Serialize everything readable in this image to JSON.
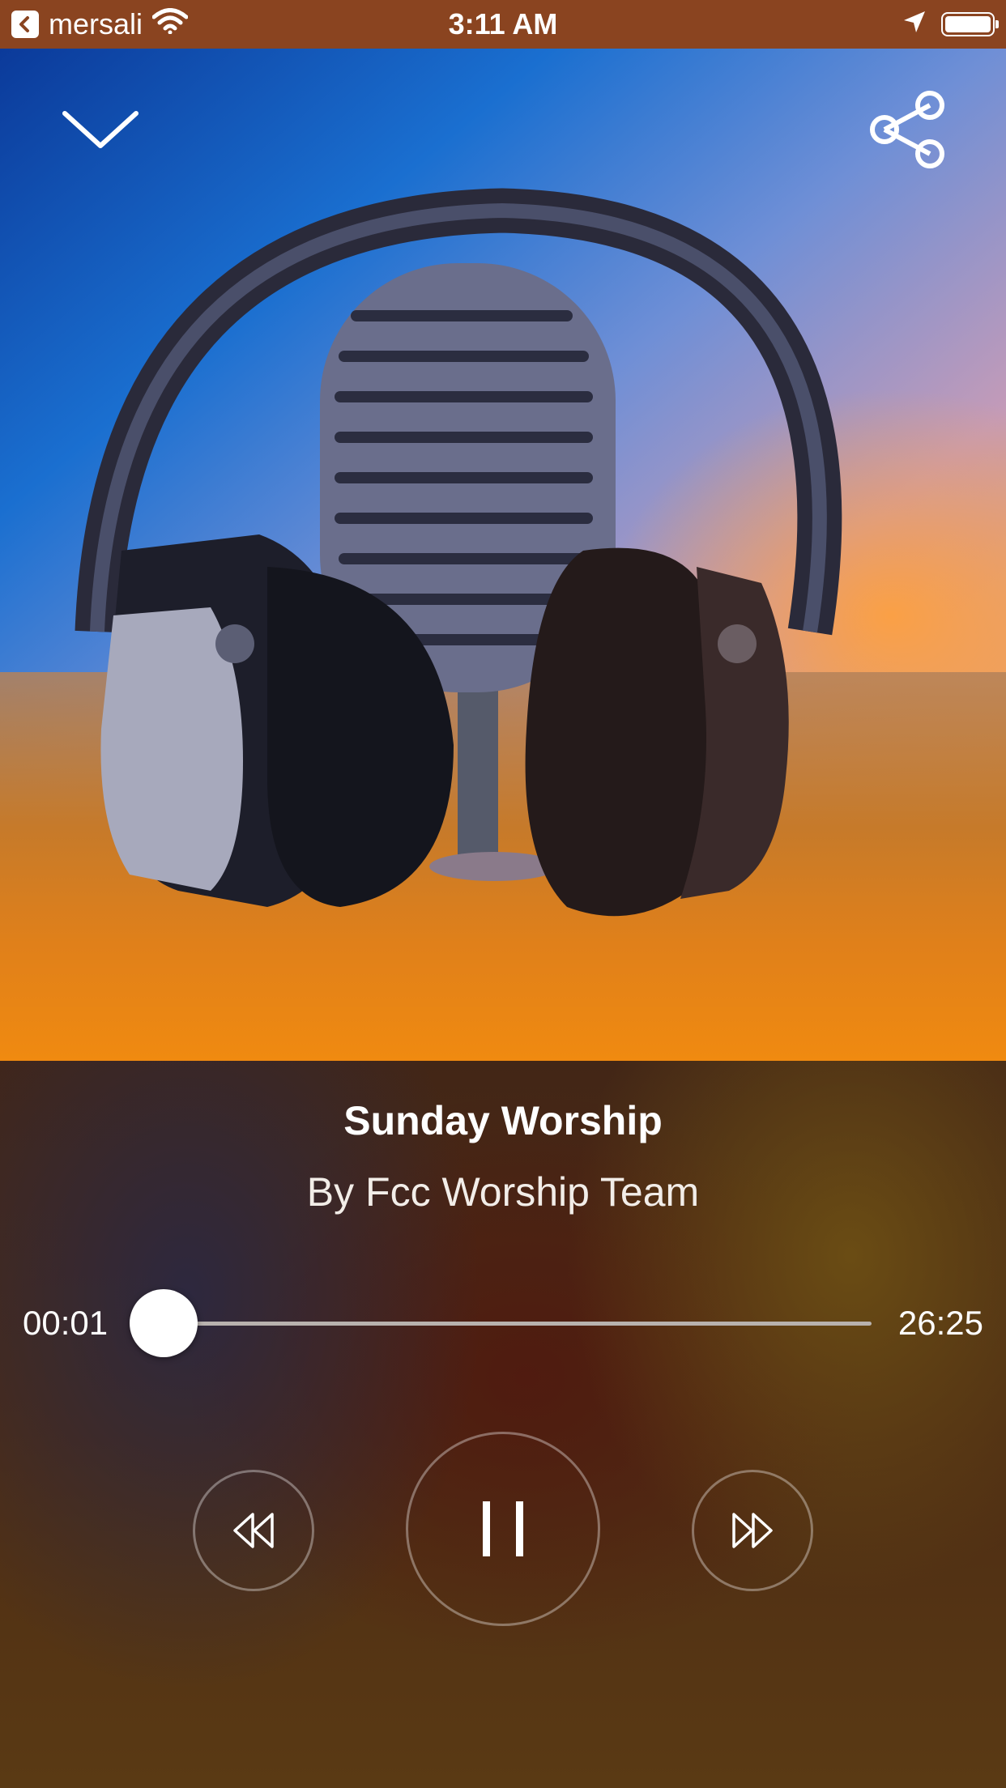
{
  "status_bar": {
    "back_app": "mersali",
    "time": "3:11 AM"
  },
  "player": {
    "title": "Sunday Worship",
    "artist": "By Fcc Worship Team",
    "current_time": "00:01",
    "total_time": "26:25",
    "progress": 0.0006
  },
  "icons": {
    "collapse": "chevron-down-icon",
    "share": "share-icon",
    "rewind": "rewind-icon",
    "pause": "pause-icon",
    "forward": "fast-forward-icon"
  },
  "colors": {
    "status_bar_bg": "#8a4420",
    "accent": "#ffffff"
  }
}
